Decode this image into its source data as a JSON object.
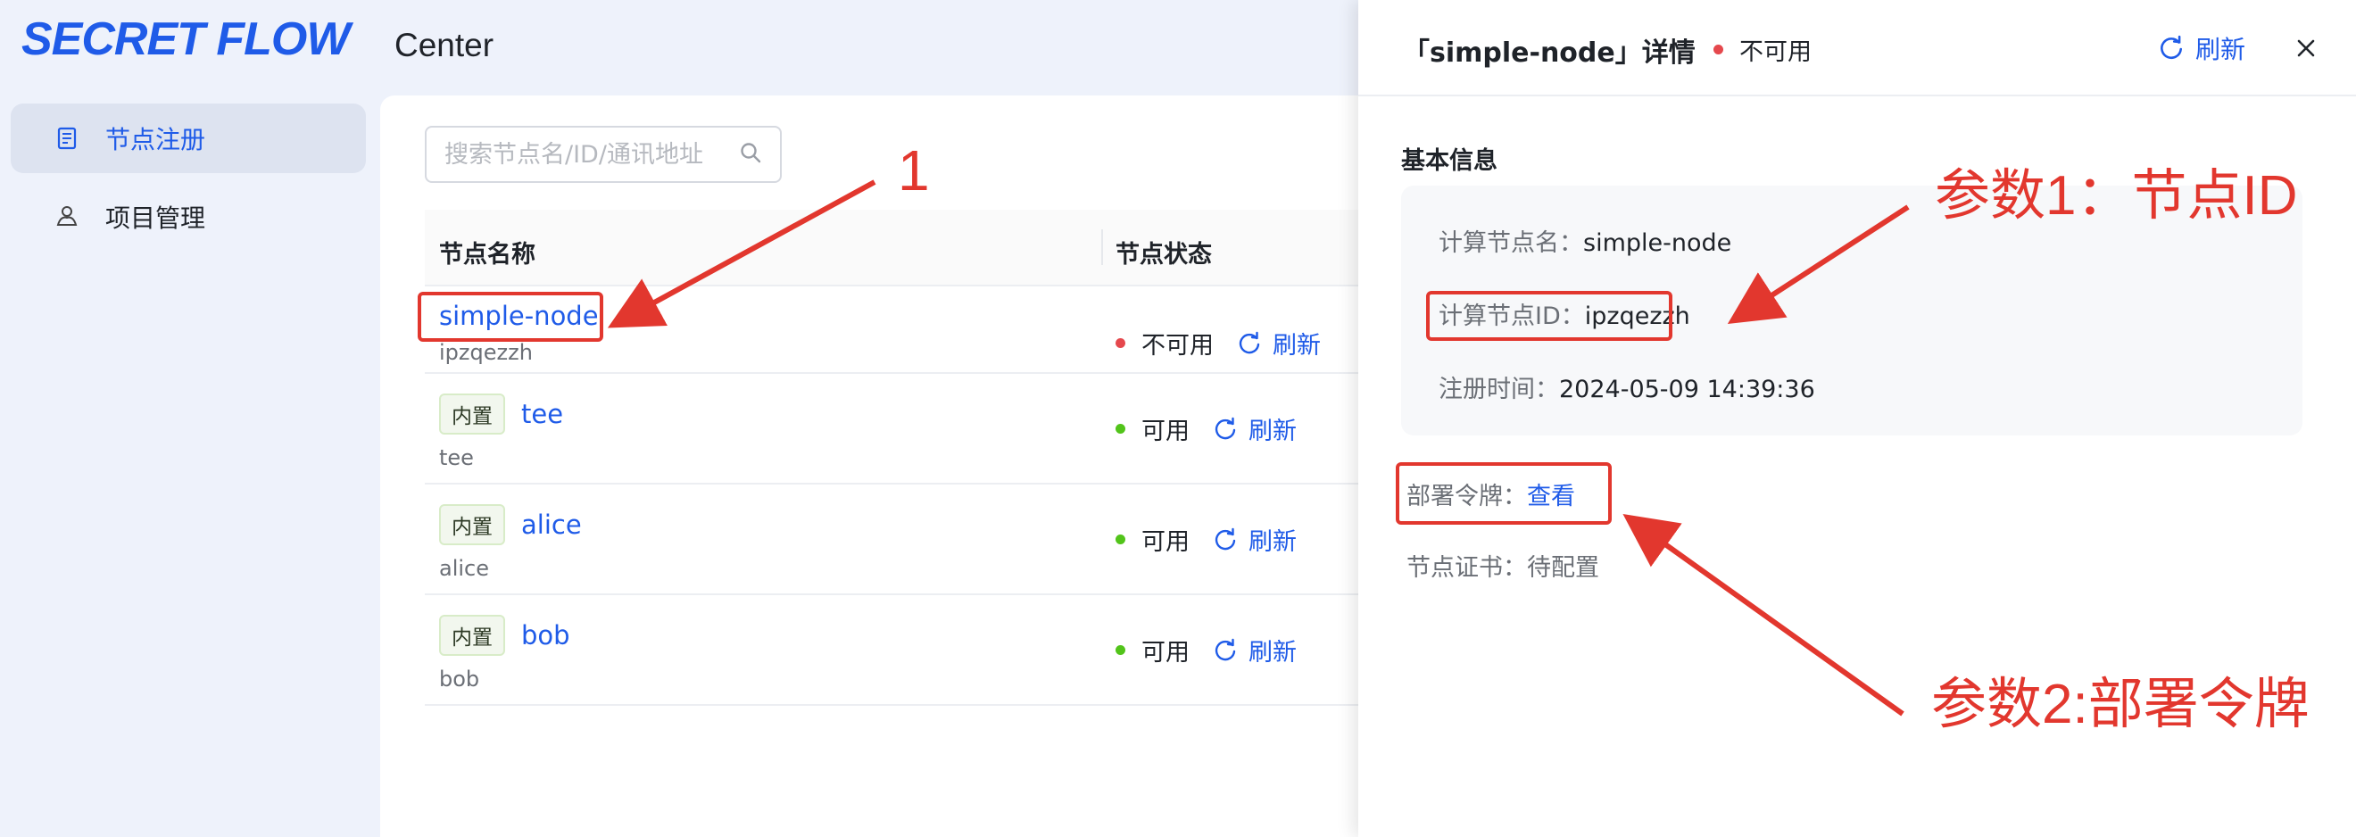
{
  "app": {
    "logo": "SECRET FLOW",
    "header_title": "Center"
  },
  "sidebar": {
    "items": [
      {
        "label": "节点注册",
        "icon": "node-register-icon",
        "active": true
      },
      {
        "label": "项目管理",
        "icon": "project-manage-icon",
        "active": false
      }
    ]
  },
  "search": {
    "placeholder": "搜索节点名/ID/通讯地址"
  },
  "table": {
    "headers": {
      "name": "节点名称",
      "status": "节点状态"
    },
    "rows": [
      {
        "name": "simple-node",
        "id": "ipzqezzh",
        "tag": "",
        "status": "不可用",
        "status_color": "#e5484d",
        "action": "刷新"
      },
      {
        "name": "tee",
        "id": "tee",
        "tag": "内置",
        "status": "可用",
        "status_color": "#52c41a",
        "action": "刷新"
      },
      {
        "name": "alice",
        "id": "alice",
        "tag": "内置",
        "status": "可用",
        "status_color": "#52c41a",
        "action": "刷新"
      },
      {
        "name": "bob",
        "id": "bob",
        "tag": "内置",
        "status": "可用",
        "status_color": "#52c41a",
        "action": "刷新"
      }
    ]
  },
  "drawer": {
    "title": "「simple-node」详情",
    "status": "不可用",
    "refresh": "刷新",
    "section_title": "基本信息",
    "info": {
      "name_label": "计算节点名：",
      "name_value": "simple-node",
      "id_label": "计算节点ID：",
      "id_value": "ipzqezzh",
      "time_label": "注册时间：",
      "time_value": "2024-05-09 14:39:36"
    },
    "token_label": "部署令牌：",
    "token_action": "查看",
    "cert_label": "节点证书：",
    "cert_value": "待配置"
  },
  "annotations": {
    "label_1": "1",
    "label_param1": "参数1：节点ID",
    "label_param2": "参数2:部署令牌",
    "color": "#e2372e"
  },
  "colors": {
    "primary": "#1f5be8",
    "error": "#e5484d",
    "success": "#52c41a"
  }
}
